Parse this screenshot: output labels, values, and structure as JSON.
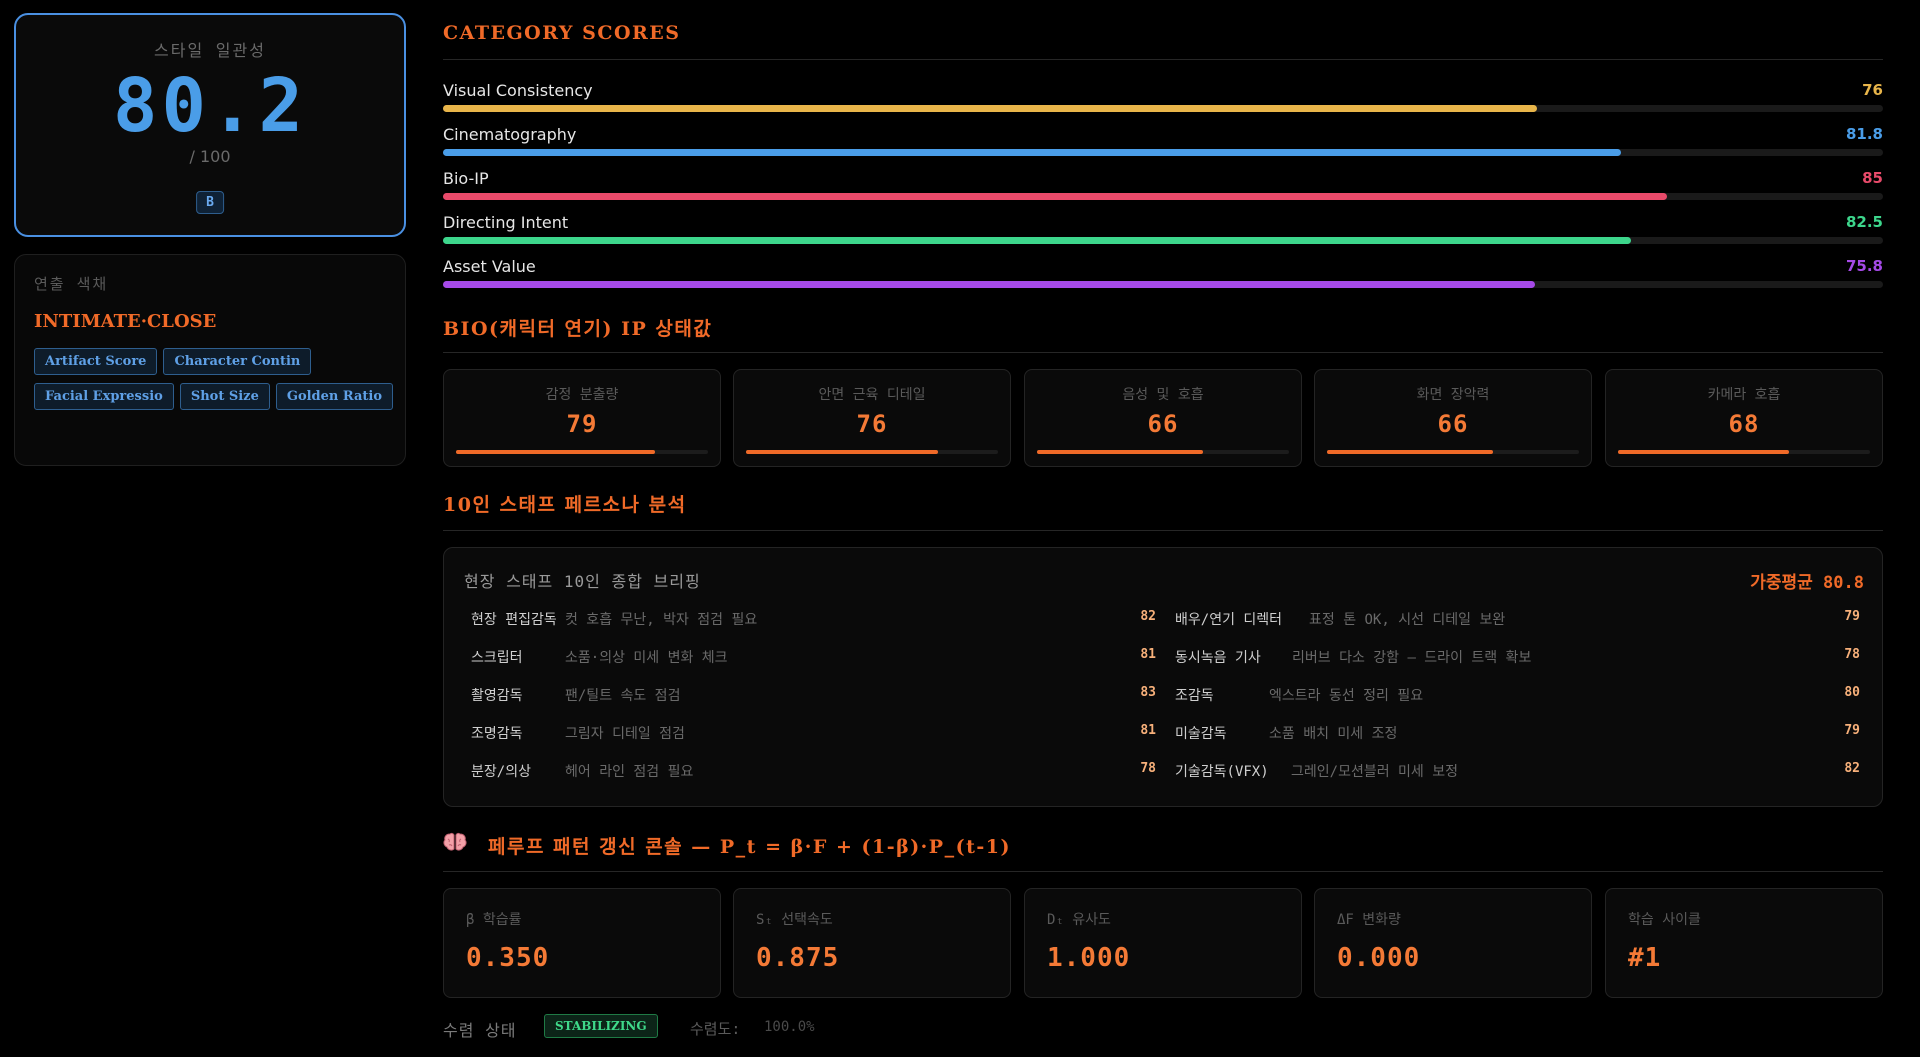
{
  "score_card": {
    "label": "스타일 일관성",
    "value": "80.2",
    "max": "/ 100",
    "grade": "B"
  },
  "style_card": {
    "label": "연출 색채",
    "value": "INTIMATE·CLOSE",
    "tags": [
      "Artifact Score",
      "Character Contin",
      "Facial Expressio",
      "Shot Size",
      "Golden Ratio"
    ]
  },
  "category_scores": {
    "title": "CATEGORY SCORES",
    "items": [
      {
        "name": "Visual Consistency",
        "value": "76",
        "fraction": 0.76,
        "color": "#e8b54a"
      },
      {
        "name": "Cinematography",
        "value": "81.8",
        "fraction": 0.818,
        "color": "#4a9de8"
      },
      {
        "name": "Bio-IP",
        "value": "85",
        "fraction": 0.85,
        "color": "#e84a6a"
      },
      {
        "name": "Directing Intent",
        "value": "82.5",
        "fraction": 0.825,
        "color": "#3dd68c"
      },
      {
        "name": "Asset Value",
        "value": "75.8",
        "fraction": 0.758,
        "color": "#a64ae8"
      }
    ]
  },
  "bio_ip": {
    "title": "BIO(캐릭터 연기) IP 상태값",
    "cards": [
      {
        "label": "감정 분출량",
        "value": "79",
        "fraction": 0.79
      },
      {
        "label": "안면 근육 디테일",
        "value": "76",
        "fraction": 0.76
      },
      {
        "label": "음성 및 호흡",
        "value": "66",
        "fraction": 0.66
      },
      {
        "label": "화면 장악력",
        "value": "66",
        "fraction": 0.66
      },
      {
        "label": "카메라 호흡",
        "value": "68",
        "fraction": 0.68
      }
    ]
  },
  "staff": {
    "title": "10인 스태프 페르소나 분석",
    "heading": "현장 스태프 10인 종합 브리핑",
    "weighted_avg": "가중평균 80.8",
    "left": [
      {
        "role": "현장 편집감독",
        "note": "컷 호흡 무난, 박자 점검 필요",
        "score": "82"
      },
      {
        "role": "스크립터",
        "note": "소품·의상 미세 변화 체크",
        "score": "81"
      },
      {
        "role": "촬영감독",
        "note": "팬/틸트 속도 점검",
        "score": "83"
      },
      {
        "role": "조명감독",
        "note": "그림자 디테일 점검",
        "score": "81"
      },
      {
        "role": "분장/의상",
        "note": "헤어 라인 점검 필요",
        "score": "78"
      }
    ],
    "right": [
      {
        "role": "배우/연기 디렉터",
        "note": "표정 톤 OK, 시선 디테일 보완",
        "score": "79"
      },
      {
        "role": "동시녹음 기사",
        "note": "리버브 다소 강함 — 드라이 트랙 확보",
        "score": "78"
      },
      {
        "role": "조감독",
        "note": "엑스트라 동선 정리 필요",
        "score": "80"
      },
      {
        "role": "미술감독",
        "note": "소품 배치 미세 조정",
        "score": "79"
      },
      {
        "role": "기술감독(VFX)",
        "note": "그레인/모션블러 미세 보정",
        "score": "82"
      }
    ]
  },
  "pattern": {
    "icon": "brain-icon",
    "title": "페루프 패턴 갱신 콘솔 — P_t = β·F + (1-β)·P_(t-1)",
    "metrics": [
      {
        "label": "β 학습률",
        "value": "0.350"
      },
      {
        "label": "Sₜ 선택속도",
        "value": "0.875"
      },
      {
        "label": "Dₜ 유사도",
        "value": "1.000"
      },
      {
        "label": "ΔF 변화량",
        "value": "0.000"
      },
      {
        "label": "학습 사이클",
        "value": "#1"
      }
    ]
  },
  "convergence": {
    "label": "수렴 상태",
    "status": "STABILIZING",
    "rate_label": "수렴도:",
    "rate": "100.0%"
  }
}
